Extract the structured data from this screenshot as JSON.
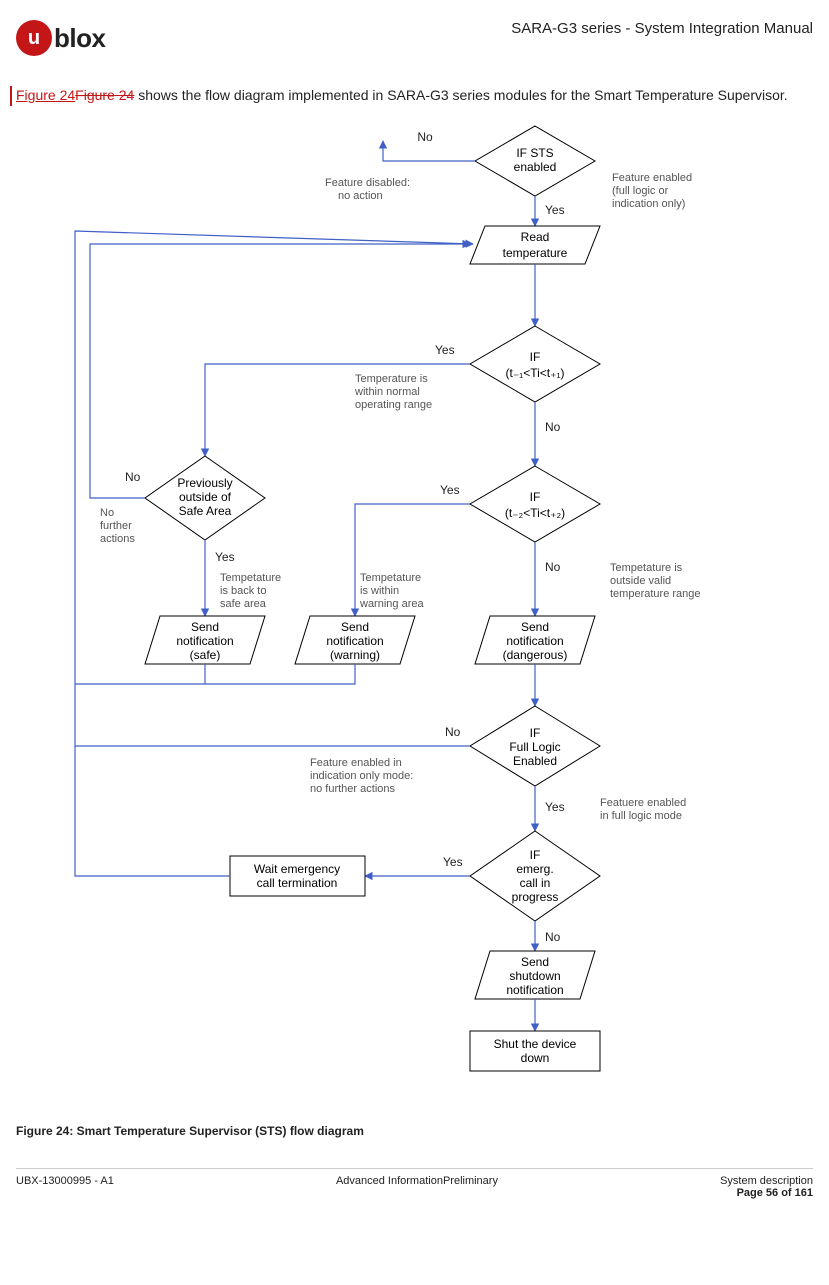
{
  "header": {
    "logo_text": "blox",
    "logo_mark": "u",
    "doc_title": "SARA-G3 series - System Integration Manual"
  },
  "intro": {
    "ref_new": "Figure 24",
    "ref_old": "Figure 24",
    "text_after": " shows the flow diagram implemented in SARA-G3 series modules for the Smart Temperature Supervisor."
  },
  "diagram": {
    "nodes": {
      "sts_enabled": "IF STS enabled",
      "read_temp": "Read temperature",
      "if_t1": "IF (t₋₁<Ti<t₊₁)",
      "if_t2": "IF (t₋₂<Ti<t₊₂)",
      "prev_outside": "Previously outside of Safe Area",
      "notif_safe": "Send notification (safe)",
      "notif_warn": "Send notification (warning)",
      "notif_danger": "Send notification (dangerous)",
      "full_logic": "IF Full Logic Enabled",
      "emerg_call": "IF emerg. call in progress",
      "wait_emerg": "Wait emergency call termination",
      "shutdown_notif": "Send shutdown notification",
      "shut_down": "Shut the device down"
    },
    "labels": {
      "yes": "Yes",
      "no": "No"
    },
    "annotations": {
      "feat_disabled": "Feature disabled: no action",
      "feat_enabled": "Feature enabled (full logic or indication only)",
      "temp_normal": "Temperature is within normal operating range",
      "no_further": "No further actions",
      "temp_back_safe": "Tempetature is back to safe area",
      "temp_warn": "Tempetature is within warning area",
      "temp_outside": "Tempetature is outside valid temperature range",
      "ind_only": "Feature enabled in indication only mode: no  further actions",
      "full_mode": "Featuere enabled in full logic mode"
    }
  },
  "caption": "Figure 24: Smart Temperature Supervisor (STS) flow diagram",
  "footer": {
    "left": "UBX-13000995 - A1",
    "mid": "Advanced InformationPreliminary",
    "right_top": "System description",
    "right_bottom": "Page 56 of 161"
  }
}
